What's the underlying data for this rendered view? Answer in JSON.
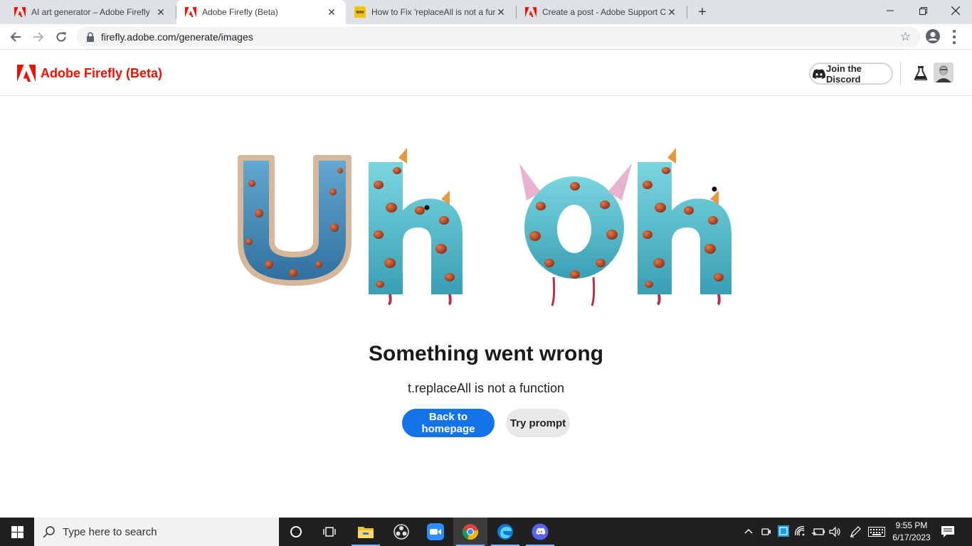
{
  "browser": {
    "tabs": [
      {
        "title": "AI art generator – Adobe Firefly",
        "favicon": "adobe-icon",
        "active": false
      },
      {
        "title": "Adobe Firefly (Beta)",
        "favicon": "adobe-icon",
        "active": true
      },
      {
        "title": "How to Fix 'replaceAll is not a fun",
        "favicon": "ww-icon",
        "active": false
      },
      {
        "title": "Create a post - Adobe Support C",
        "favicon": "adobe-icon",
        "active": false
      }
    ],
    "ww_favicon_text": "ww",
    "url": "firefly.adobe.com/generate/images"
  },
  "header": {
    "title": "Adobe Firefly (Beta)",
    "discord_label": "Join the Discord"
  },
  "main": {
    "hero_alt": "Uh oh",
    "error_title": "Something went wrong",
    "error_message": "t.replaceAll is not a function",
    "primary_button": "Back to homepage",
    "secondary_button": "Try prompt"
  },
  "taskbar": {
    "search_placeholder": "Type here to search",
    "time": "9:55 PM",
    "date": "6/17/2023"
  },
  "colors": {
    "adobe_red": "#eb1000",
    "primary_blue": "#1473e6",
    "taskbar_bg": "#202020",
    "tabstrip_bg": "#dee1e6"
  }
}
